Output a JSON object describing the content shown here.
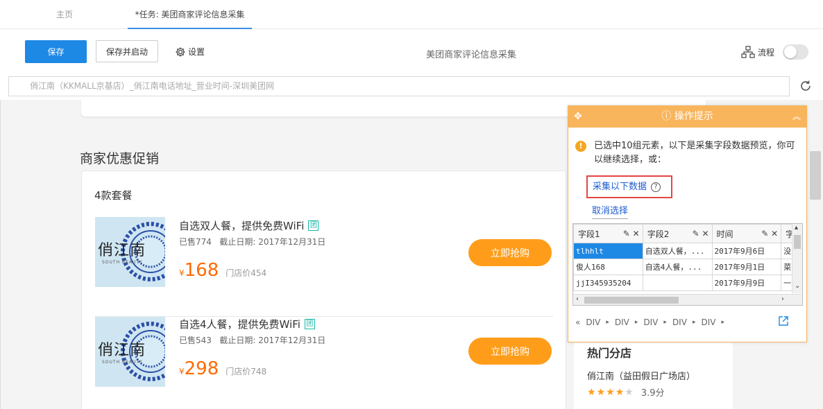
{
  "tabs": [
    {
      "label": "主页"
    },
    {
      "label": "*任务: 美团商家评论信息采集"
    }
  ],
  "toolbar": {
    "save_label": "保存",
    "save_start_label": "保存并启动",
    "settings_label": "设置",
    "task_title": "美团商家评论信息采集",
    "flow_label": "流程"
  },
  "urlbar": {
    "value": "俏江南（KKMALL京基店）_俏江南电话地址_营业时间-深圳美团网"
  },
  "page": {
    "promo_title": "商家优惠促销",
    "package_count": "4款套餐",
    "thumb_brand": "俏江南",
    "thumb_sub": "SOUTH BEAUTY",
    "tuan_badge": "团",
    "deals": [
      {
        "name": "自选双人餐，提供免费WiFi",
        "sold": "已售774",
        "deadline": "截止日期: 2017年12月31日",
        "currency": "¥",
        "price": "168",
        "store_price": "门店价454",
        "buy_label": "立即抢购"
      },
      {
        "name": "自选4人餐，提供免费WiFi",
        "sold": "已售543",
        "deadline": "截止日期: 2017年12月31日",
        "currency": "¥",
        "price": "298",
        "store_price": "门店价748",
        "buy_label": "立即抢购"
      }
    ],
    "side": {
      "title": "热门分店",
      "shop_name": "俏江南（益田假日广场店）",
      "rating": 3.9,
      "rating_label": "3.9分"
    }
  },
  "hint_panel": {
    "title": "操作提示",
    "message": "已选中10组元素，以下是采集字段数据预览，你可以继续选择，或：",
    "collect_label": "采集以下数据",
    "cancel_label": "取消选择",
    "columns": [
      "字段1",
      "字段2",
      "时间",
      "字"
    ],
    "rows": [
      [
        "tlhhlt",
        "自选双人餐，...",
        "2017年9月6日",
        "没"
      ],
      [
        "俊人168",
        "自选4人餐，...",
        "2017年9月1日",
        "菜"
      ],
      [
        "jjI345935204",
        "",
        "2017年9月9日",
        "一"
      ]
    ],
    "path_prefix": "«",
    "path": [
      "DIV",
      "DIV",
      "DIV",
      "DIV",
      "DIV"
    ]
  }
}
